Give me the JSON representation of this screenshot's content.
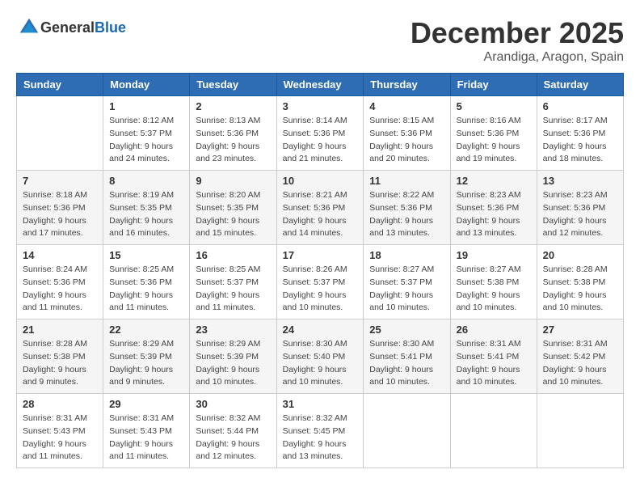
{
  "header": {
    "logo_general": "General",
    "logo_blue": "Blue",
    "month": "December 2025",
    "location": "Arandiga, Aragon, Spain"
  },
  "weekdays": [
    "Sunday",
    "Monday",
    "Tuesday",
    "Wednesday",
    "Thursday",
    "Friday",
    "Saturday"
  ],
  "weeks": [
    [
      {
        "day": "",
        "sunrise": "",
        "sunset": "",
        "daylight": ""
      },
      {
        "day": "1",
        "sunrise": "Sunrise: 8:12 AM",
        "sunset": "Sunset: 5:37 PM",
        "daylight": "Daylight: 9 hours and 24 minutes."
      },
      {
        "day": "2",
        "sunrise": "Sunrise: 8:13 AM",
        "sunset": "Sunset: 5:36 PM",
        "daylight": "Daylight: 9 hours and 23 minutes."
      },
      {
        "day": "3",
        "sunrise": "Sunrise: 8:14 AM",
        "sunset": "Sunset: 5:36 PM",
        "daylight": "Daylight: 9 hours and 21 minutes."
      },
      {
        "day": "4",
        "sunrise": "Sunrise: 8:15 AM",
        "sunset": "Sunset: 5:36 PM",
        "daylight": "Daylight: 9 hours and 20 minutes."
      },
      {
        "day": "5",
        "sunrise": "Sunrise: 8:16 AM",
        "sunset": "Sunset: 5:36 PM",
        "daylight": "Daylight: 9 hours and 19 minutes."
      },
      {
        "day": "6",
        "sunrise": "Sunrise: 8:17 AM",
        "sunset": "Sunset: 5:36 PM",
        "daylight": "Daylight: 9 hours and 18 minutes."
      }
    ],
    [
      {
        "day": "7",
        "sunrise": "Sunrise: 8:18 AM",
        "sunset": "Sunset: 5:36 PM",
        "daylight": "Daylight: 9 hours and 17 minutes."
      },
      {
        "day": "8",
        "sunrise": "Sunrise: 8:19 AM",
        "sunset": "Sunset: 5:35 PM",
        "daylight": "Daylight: 9 hours and 16 minutes."
      },
      {
        "day": "9",
        "sunrise": "Sunrise: 8:20 AM",
        "sunset": "Sunset: 5:35 PM",
        "daylight": "Daylight: 9 hours and 15 minutes."
      },
      {
        "day": "10",
        "sunrise": "Sunrise: 8:21 AM",
        "sunset": "Sunset: 5:36 PM",
        "daylight": "Daylight: 9 hours and 14 minutes."
      },
      {
        "day": "11",
        "sunrise": "Sunrise: 8:22 AM",
        "sunset": "Sunset: 5:36 PM",
        "daylight": "Daylight: 9 hours and 13 minutes."
      },
      {
        "day": "12",
        "sunrise": "Sunrise: 8:23 AM",
        "sunset": "Sunset: 5:36 PM",
        "daylight": "Daylight: 9 hours and 13 minutes."
      },
      {
        "day": "13",
        "sunrise": "Sunrise: 8:23 AM",
        "sunset": "Sunset: 5:36 PM",
        "daylight": "Daylight: 9 hours and 12 minutes."
      }
    ],
    [
      {
        "day": "14",
        "sunrise": "Sunrise: 8:24 AM",
        "sunset": "Sunset: 5:36 PM",
        "daylight": "Daylight: 9 hours and 11 minutes."
      },
      {
        "day": "15",
        "sunrise": "Sunrise: 8:25 AM",
        "sunset": "Sunset: 5:36 PM",
        "daylight": "Daylight: 9 hours and 11 minutes."
      },
      {
        "day": "16",
        "sunrise": "Sunrise: 8:25 AM",
        "sunset": "Sunset: 5:37 PM",
        "daylight": "Daylight: 9 hours and 11 minutes."
      },
      {
        "day": "17",
        "sunrise": "Sunrise: 8:26 AM",
        "sunset": "Sunset: 5:37 PM",
        "daylight": "Daylight: 9 hours and 10 minutes."
      },
      {
        "day": "18",
        "sunrise": "Sunrise: 8:27 AM",
        "sunset": "Sunset: 5:37 PM",
        "daylight": "Daylight: 9 hours and 10 minutes."
      },
      {
        "day": "19",
        "sunrise": "Sunrise: 8:27 AM",
        "sunset": "Sunset: 5:38 PM",
        "daylight": "Daylight: 9 hours and 10 minutes."
      },
      {
        "day": "20",
        "sunrise": "Sunrise: 8:28 AM",
        "sunset": "Sunset: 5:38 PM",
        "daylight": "Daylight: 9 hours and 10 minutes."
      }
    ],
    [
      {
        "day": "21",
        "sunrise": "Sunrise: 8:28 AM",
        "sunset": "Sunset: 5:38 PM",
        "daylight": "Daylight: 9 hours and 9 minutes."
      },
      {
        "day": "22",
        "sunrise": "Sunrise: 8:29 AM",
        "sunset": "Sunset: 5:39 PM",
        "daylight": "Daylight: 9 hours and 9 minutes."
      },
      {
        "day": "23",
        "sunrise": "Sunrise: 8:29 AM",
        "sunset": "Sunset: 5:39 PM",
        "daylight": "Daylight: 9 hours and 10 minutes."
      },
      {
        "day": "24",
        "sunrise": "Sunrise: 8:30 AM",
        "sunset": "Sunset: 5:40 PM",
        "daylight": "Daylight: 9 hours and 10 minutes."
      },
      {
        "day": "25",
        "sunrise": "Sunrise: 8:30 AM",
        "sunset": "Sunset: 5:41 PM",
        "daylight": "Daylight: 9 hours and 10 minutes."
      },
      {
        "day": "26",
        "sunrise": "Sunrise: 8:31 AM",
        "sunset": "Sunset: 5:41 PM",
        "daylight": "Daylight: 9 hours and 10 minutes."
      },
      {
        "day": "27",
        "sunrise": "Sunrise: 8:31 AM",
        "sunset": "Sunset: 5:42 PM",
        "daylight": "Daylight: 9 hours and 10 minutes."
      }
    ],
    [
      {
        "day": "28",
        "sunrise": "Sunrise: 8:31 AM",
        "sunset": "Sunset: 5:43 PM",
        "daylight": "Daylight: 9 hours and 11 minutes."
      },
      {
        "day": "29",
        "sunrise": "Sunrise: 8:31 AM",
        "sunset": "Sunset: 5:43 PM",
        "daylight": "Daylight: 9 hours and 11 minutes."
      },
      {
        "day": "30",
        "sunrise": "Sunrise: 8:32 AM",
        "sunset": "Sunset: 5:44 PM",
        "daylight": "Daylight: 9 hours and 12 minutes."
      },
      {
        "day": "31",
        "sunrise": "Sunrise: 8:32 AM",
        "sunset": "Sunset: 5:45 PM",
        "daylight": "Daylight: 9 hours and 13 minutes."
      },
      {
        "day": "",
        "sunrise": "",
        "sunset": "",
        "daylight": ""
      },
      {
        "day": "",
        "sunrise": "",
        "sunset": "",
        "daylight": ""
      },
      {
        "day": "",
        "sunrise": "",
        "sunset": "",
        "daylight": ""
      }
    ]
  ]
}
